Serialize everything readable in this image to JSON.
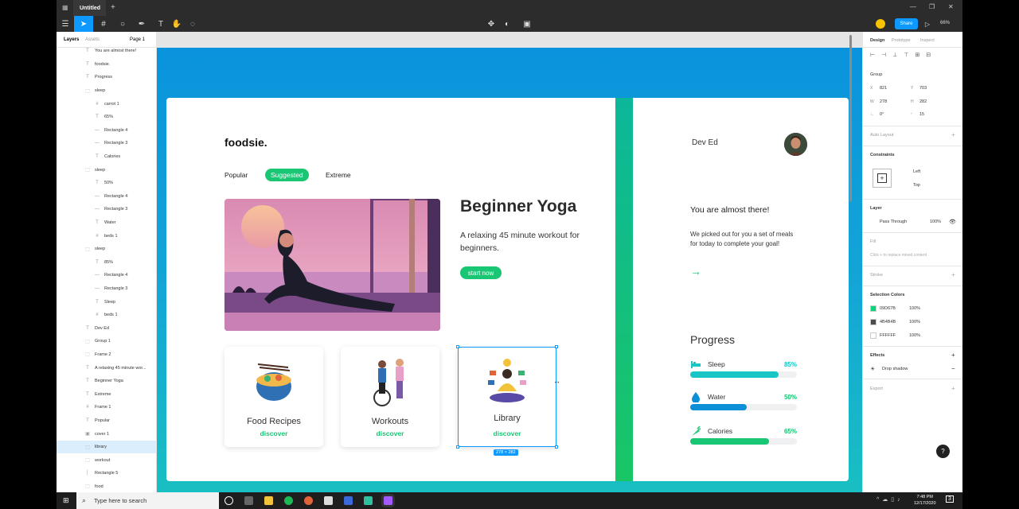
{
  "window": {
    "tab_title": "Untitled",
    "plus": "+",
    "minimize": "—",
    "restore": "❐",
    "close": "✕"
  },
  "toolbar": {
    "share_label": "Share",
    "zoom": "66%",
    "play": "▷"
  },
  "left_panel": {
    "tabs": [
      "Layers",
      "Assets",
      "Page 1"
    ],
    "layers": [
      {
        "icon": "T",
        "label": "You are almost there!",
        "indent": 1
      },
      {
        "icon": "T",
        "label": "foodsie.",
        "indent": 1
      },
      {
        "icon": "T",
        "label": "Progress",
        "indent": 1
      },
      {
        "icon": "⬚",
        "label": "sleep",
        "indent": 1
      },
      {
        "icon": "#",
        "label": "carrot 1",
        "indent": 2
      },
      {
        "icon": "T",
        "label": "65%",
        "indent": 2
      },
      {
        "icon": "—",
        "label": "Rectangle 4",
        "indent": 2
      },
      {
        "icon": "—",
        "label": "Rectangle 3",
        "indent": 2
      },
      {
        "icon": "T",
        "label": "Calories",
        "indent": 2
      },
      {
        "icon": "⬚",
        "label": "sleep",
        "indent": 1
      },
      {
        "icon": "T",
        "label": "50%",
        "indent": 2
      },
      {
        "icon": "—",
        "label": "Rectangle 4",
        "indent": 2
      },
      {
        "icon": "—",
        "label": "Rectangle 3",
        "indent": 2
      },
      {
        "icon": "T",
        "label": "Water",
        "indent": 2
      },
      {
        "icon": "#",
        "label": "beds 1",
        "indent": 2
      },
      {
        "icon": "⬚",
        "label": "sleep",
        "indent": 1
      },
      {
        "icon": "T",
        "label": "85%",
        "indent": 2
      },
      {
        "icon": "—",
        "label": "Rectangle 4",
        "indent": 2
      },
      {
        "icon": "—",
        "label": "Rectangle 3",
        "indent": 2
      },
      {
        "icon": "T",
        "label": "Sleep",
        "indent": 2
      },
      {
        "icon": "#",
        "label": "beds 1",
        "indent": 2
      },
      {
        "icon": "T",
        "label": "Dev Ed",
        "indent": 1
      },
      {
        "icon": "⬚",
        "label": "Group 1",
        "indent": 1
      },
      {
        "icon": "⬚",
        "label": "Frame 2",
        "indent": 1
      },
      {
        "icon": "T",
        "label": "A relaxing 45 minute wor...",
        "indent": 1
      },
      {
        "icon": "T",
        "label": "Beginner Yoga",
        "indent": 1
      },
      {
        "icon": "T",
        "label": "Extreme",
        "indent": 1
      },
      {
        "icon": "#",
        "label": "Frame 1",
        "indent": 1
      },
      {
        "icon": "T",
        "label": "Popular",
        "indent": 1
      },
      {
        "icon": "▣",
        "label": "cover 1",
        "indent": 1
      },
      {
        "icon": "⬚",
        "label": "library",
        "indent": 1,
        "selected": true
      },
      {
        "icon": "⬚",
        "label": "workout",
        "indent": 1
      },
      {
        "icon": "│",
        "label": "Rectangle 5",
        "indent": 1
      },
      {
        "icon": "⬚",
        "label": "food",
        "indent": 1
      }
    ]
  },
  "design": {
    "logo": "foodsie.",
    "nav": [
      "Popular",
      "Suggested",
      "Extreme"
    ],
    "hero_title": "Beginner Yoga",
    "hero_desc": "A relaxing 45 minute workout for beginners.",
    "start_label": "start now",
    "cards": [
      {
        "title": "Food Recipes",
        "link": "discover"
      },
      {
        "title": "Workouts",
        "link": "discover"
      },
      {
        "title": "Library",
        "link": "discover"
      }
    ],
    "selection_size": "278 × 282",
    "user_name": "Dev Ed",
    "almost_title": "You are almost there!",
    "almost_desc": "We picked out for you a set of meals for today to complete your goal!",
    "arrow": "→",
    "progress_title": "Progress",
    "progress": [
      {
        "label": "Sleep",
        "pct_label": "85%",
        "value": 0.83,
        "color": "#19c6c6"
      },
      {
        "label": "Water",
        "pct_label": "50%",
        "value": 0.53,
        "color": "#0d8fd8"
      },
      {
        "label": "Calories",
        "pct_label": "65%",
        "value": 0.74,
        "color": "#19c674"
      }
    ]
  },
  "right_panel": {
    "tabs": [
      "Design",
      "Prototype",
      "Inspect"
    ],
    "group_label": "Group",
    "x_label": "X",
    "x_val": "821",
    "y_label": "Y",
    "y_val": "703",
    "w_label": "W",
    "w_val": "278",
    "h_label": "H",
    "h_val": "282",
    "rot_label": "∟",
    "rot_val": "0°",
    "radius_label": "◜",
    "radius_val": "15",
    "auto_layout": "Auto Layout",
    "constraints": "Constraints",
    "c_left": "Left",
    "c_top": "Top",
    "layer": "Layer",
    "blend": "Pass Through",
    "opacity": "100%",
    "fill": "Fill",
    "fill_hint": "Click + to replace mixed content",
    "stroke": "Stroke",
    "sel_colors": "Selection Colors",
    "colors": [
      {
        "hex": "09D67B",
        "swatch": "#09d67b",
        "pct": "100%"
      },
      {
        "hex": "4B4B4B",
        "swatch": "#4b4b4b",
        "pct": "100%"
      },
      {
        "hex": "FFFFFF",
        "swatch": "#ffffff",
        "pct": "100%"
      }
    ],
    "effects": "Effects",
    "drop_shadow": "Drop shadow",
    "export": "Export"
  },
  "taskbar": {
    "search_placeholder": "Type here to search",
    "time": "7:48 PM",
    "date": "12/17/2020",
    "notif": "3"
  },
  "help": "?"
}
